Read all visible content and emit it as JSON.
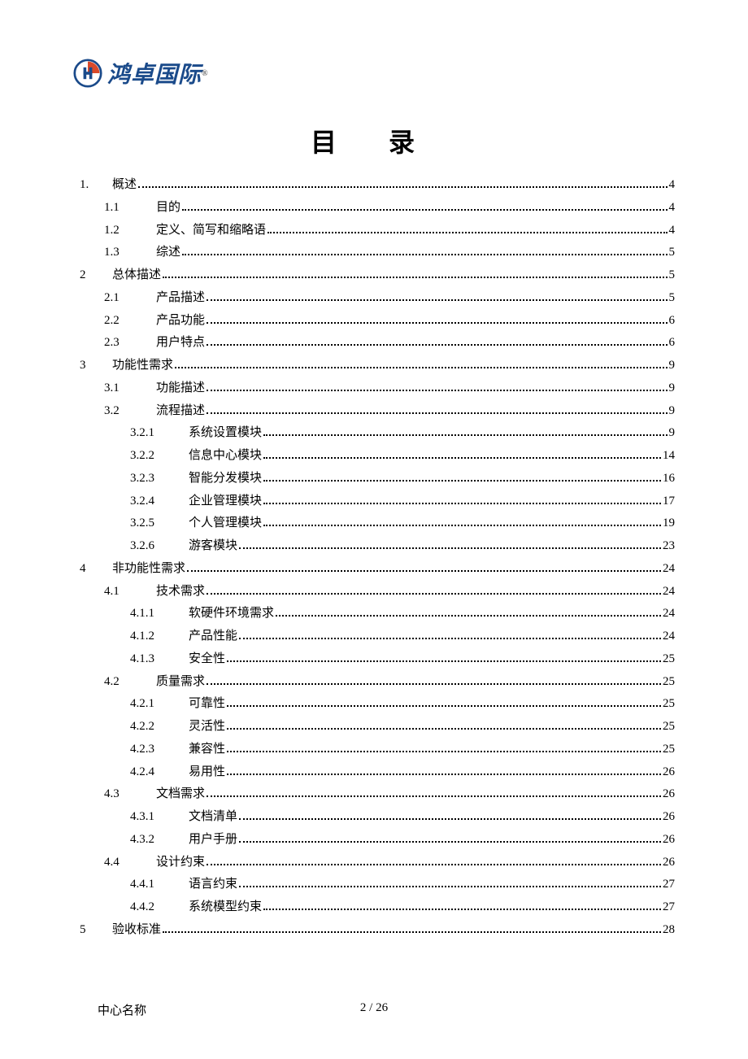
{
  "logo": {
    "text": "鸿卓国际"
  },
  "toc_title": "目 录",
  "entries": [
    {
      "level": 1,
      "num": "1.",
      "label": "概述",
      "page": "4"
    },
    {
      "level": 2,
      "num": "1.1",
      "label": "目的",
      "page": "4"
    },
    {
      "level": 2,
      "num": "1.2",
      "label": "定义、简写和缩略语",
      "page": "4"
    },
    {
      "level": 2,
      "num": "1.3",
      "label": "综述",
      "page": "5"
    },
    {
      "level": 1,
      "num": "2",
      "label": "总体描述",
      "page": "5"
    },
    {
      "level": 2,
      "num": "2.1",
      "label": "产品描述",
      "page": "5"
    },
    {
      "level": 2,
      "num": "2.2",
      "label": "产品功能",
      "page": "6"
    },
    {
      "level": 2,
      "num": "2.3",
      "label": "用户特点",
      "page": "6"
    },
    {
      "level": 1,
      "num": "3",
      "label": "功能性需求",
      "page": "9"
    },
    {
      "level": 2,
      "num": "3.1",
      "label": "功能描述",
      "page": "9"
    },
    {
      "level": 2,
      "num": "3.2",
      "label": "流程描述",
      "page": "9"
    },
    {
      "level": 3,
      "num": "3.2.1",
      "label": "系统设置模块",
      "page": "9"
    },
    {
      "level": 3,
      "num": "3.2.2",
      "label": "信息中心模块",
      "page": "14"
    },
    {
      "level": 3,
      "num": "3.2.3",
      "label": "智能分发模块",
      "page": "16"
    },
    {
      "level": 3,
      "num": "3.2.4",
      "label": "企业管理模块",
      "page": "17"
    },
    {
      "level": 3,
      "num": "3.2.5",
      "label": "个人管理模块",
      "page": "19"
    },
    {
      "level": 3,
      "num": "3.2.6",
      "label": "游客模块",
      "page": "23"
    },
    {
      "level": 1,
      "num": "4",
      "label": "非功能性需求",
      "page": "24"
    },
    {
      "level": 2,
      "num": "4.1",
      "label": "技术需求",
      "page": "24"
    },
    {
      "level": 3,
      "num": "4.1.1",
      "label": "软硬件环境需求",
      "page": "24"
    },
    {
      "level": 3,
      "num": "4.1.2",
      "label": "产品性能",
      "page": "24"
    },
    {
      "level": 3,
      "num": "4.1.3",
      "label": "安全性",
      "page": "25"
    },
    {
      "level": 2,
      "num": "4.2",
      "label": "质量需求",
      "page": "25"
    },
    {
      "level": 3,
      "num": "4.2.1",
      "label": "可靠性",
      "page": "25"
    },
    {
      "level": 3,
      "num": "4.2.2",
      "label": "灵活性",
      "page": "25"
    },
    {
      "level": 3,
      "num": "4.2.3",
      "label": "兼容性",
      "page": "25"
    },
    {
      "level": 3,
      "num": "4.2.4",
      "label": "易用性",
      "page": "26"
    },
    {
      "level": 2,
      "num": "4.3",
      "label": "文档需求",
      "page": "26"
    },
    {
      "level": 3,
      "num": "4.3.1",
      "label": "文档清单",
      "page": "26"
    },
    {
      "level": 3,
      "num": "4.3.2",
      "label": "用户手册",
      "page": "26"
    },
    {
      "level": 2,
      "num": "4.4",
      "label": "设计约束",
      "page": "26"
    },
    {
      "level": 3,
      "num": "4.4.1",
      "label": "语言约束",
      "page": "27"
    },
    {
      "level": 3,
      "num": "4.4.2",
      "label": "系统模型约束",
      "page": "27"
    },
    {
      "level": 1,
      "num": "5",
      "label": "验收标准",
      "page": "28"
    }
  ],
  "footer": {
    "center_name": "中心名称",
    "page_indicator": "2 / 26"
  }
}
